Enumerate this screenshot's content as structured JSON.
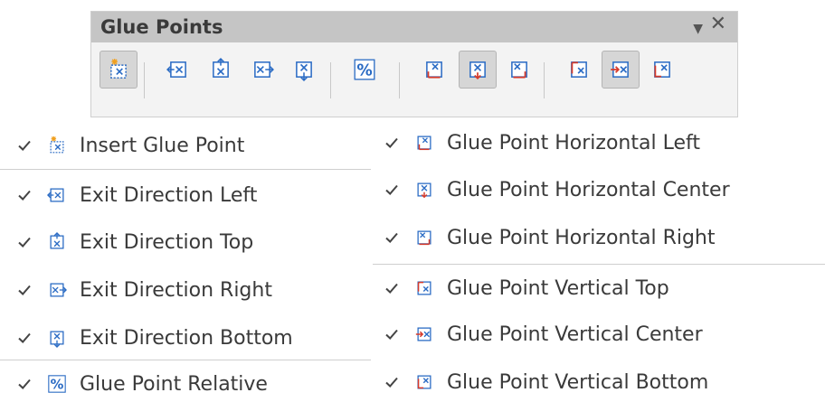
{
  "toolbar": {
    "title": "Glue Points",
    "buttons": [
      {
        "name": "insert-glue-point-button",
        "icon": "insert-glue-point-icon",
        "active": true
      },
      {
        "name": "exit-direction-left-button",
        "icon": "exit-left-icon",
        "active": false
      },
      {
        "name": "exit-direction-top-button",
        "icon": "exit-top-icon",
        "active": false
      },
      {
        "name": "exit-direction-right-button",
        "icon": "exit-right-icon",
        "active": false
      },
      {
        "name": "exit-direction-bottom-button",
        "icon": "exit-bottom-icon",
        "active": false
      },
      {
        "name": "glue-point-relative-button",
        "icon": "percent-icon",
        "active": false
      },
      {
        "name": "horizontal-left-button",
        "icon": "horizontal-left-icon",
        "active": false
      },
      {
        "name": "horizontal-center-button",
        "icon": "horizontal-center-icon",
        "active": true
      },
      {
        "name": "horizontal-right-button",
        "icon": "horizontal-right-icon",
        "active": false
      },
      {
        "name": "vertical-top-button",
        "icon": "vertical-top-icon",
        "active": false
      },
      {
        "name": "vertical-center-button",
        "icon": "vertical-center-icon",
        "active": true
      },
      {
        "name": "vertical-bottom-button",
        "icon": "vertical-bottom-icon",
        "active": false
      }
    ]
  },
  "menu": {
    "left": [
      {
        "label": "Insert Glue Point",
        "checked": true,
        "icon": "insert-glue-point-icon"
      },
      {
        "label": "Exit Direction Left",
        "checked": true,
        "icon": "exit-left-icon"
      },
      {
        "label": "Exit Direction Top",
        "checked": true,
        "icon": "exit-top-icon"
      },
      {
        "label": "Exit Direction Right",
        "checked": true,
        "icon": "exit-right-icon"
      },
      {
        "label": "Exit Direction Bottom",
        "checked": true,
        "icon": "exit-bottom-icon"
      },
      {
        "label": "Glue Point Relative",
        "checked": true,
        "icon": "percent-icon"
      }
    ],
    "right": [
      {
        "label": "Glue Point Horizontal Left",
        "checked": true,
        "icon": "horizontal-left-icon"
      },
      {
        "label": "Glue Point Horizontal Center",
        "checked": true,
        "icon": "horizontal-center-icon"
      },
      {
        "label": "Glue Point Horizontal Right",
        "checked": true,
        "icon": "horizontal-right-icon"
      },
      {
        "label": "Glue Point Vertical Top",
        "checked": true,
        "icon": "vertical-top-icon"
      },
      {
        "label": "Glue Point Vertical Center",
        "checked": true,
        "icon": "vertical-center-icon"
      },
      {
        "label": "Glue Point Vertical Bottom",
        "checked": true,
        "icon": "vertical-bottom-icon"
      }
    ]
  },
  "colors": {
    "title_bar": "#c5c5c5",
    "toolbar_bg": "#f3f3f3",
    "icon_blue": "#2a6bc4",
    "icon_red": "#d63a2a",
    "icon_orange": "#f0a020",
    "active_button": "#d6d6d6"
  }
}
